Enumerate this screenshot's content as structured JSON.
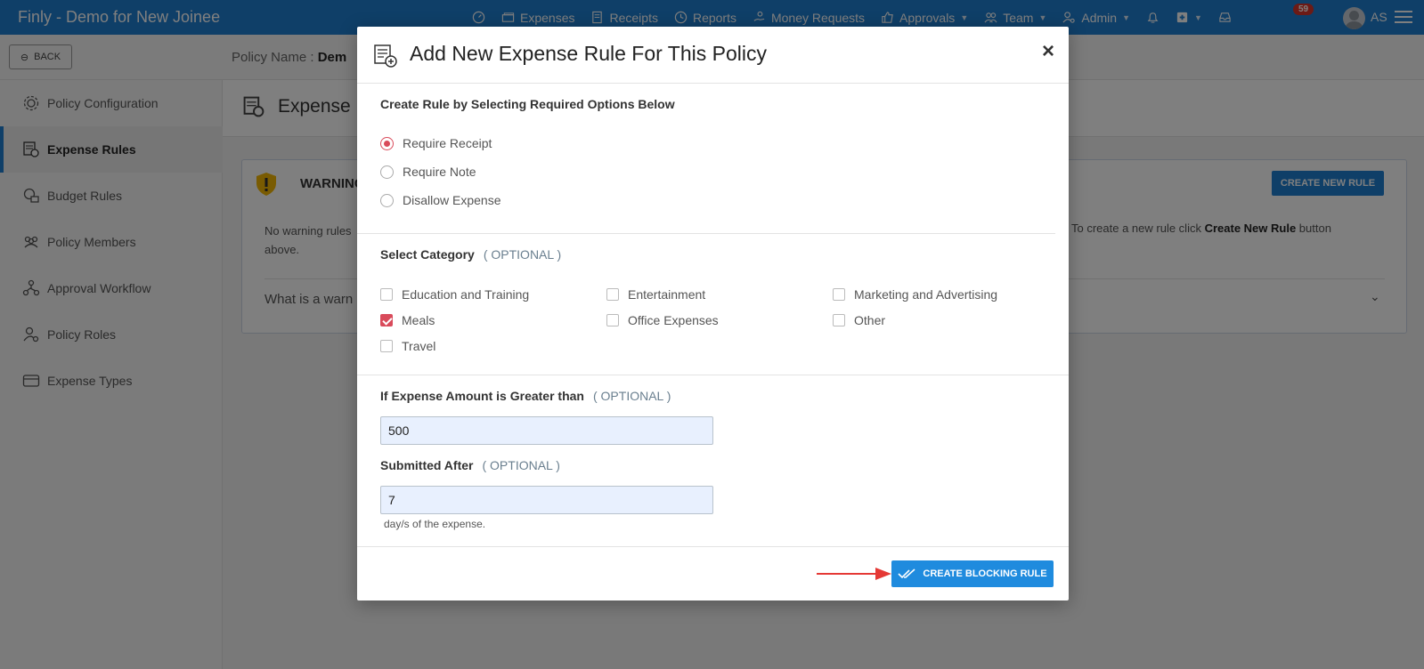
{
  "app": {
    "title": "Finly - Demo for New Joinee"
  },
  "nav": {
    "items": [
      {
        "label": ""
      },
      {
        "label": "Expenses"
      },
      {
        "label": "Receipts"
      },
      {
        "label": "Reports"
      },
      {
        "label": "Money Requests"
      },
      {
        "label": "Approvals"
      },
      {
        "label": "Team"
      },
      {
        "label": "Admin"
      }
    ],
    "inbox_count": "59",
    "user_initials": "AS"
  },
  "subbar": {
    "back_label": "BACK",
    "policy_label": "Policy Name :",
    "policy_value": "Dem"
  },
  "sidebar": {
    "items": [
      {
        "label": "Policy Configuration"
      },
      {
        "label": "Expense Rules"
      },
      {
        "label": "Budget Rules"
      },
      {
        "label": "Policy Members"
      },
      {
        "label": "Approval Workflow"
      },
      {
        "label": "Policy Roles"
      },
      {
        "label": "Expense Types"
      }
    ]
  },
  "main": {
    "title": "Expense",
    "warning_title": "WARNING",
    "create_new_rule": "CREATE NEW RULE",
    "warning_text_left": "No warning rules",
    "warning_text_left2": "above.",
    "warning_text_right_pre": "To create a new rule click ",
    "warning_text_right_bold": "Create New Rule",
    "warning_text_right_post": " button",
    "faq": "What is a warn"
  },
  "modal": {
    "title": "Add New Expense Rule For This Policy",
    "close": "×",
    "rule_section_label": "Create Rule by Selecting Required Options Below",
    "radios": [
      {
        "label": "Require Receipt",
        "selected": true
      },
      {
        "label": "Require Note",
        "selected": false
      },
      {
        "label": "Disallow Expense",
        "selected": false
      }
    ],
    "category_label": "Select Category",
    "optional": "( OPTIONAL )",
    "categories": [
      {
        "label": "Education and Training",
        "checked": false
      },
      {
        "label": "Entertainment",
        "checked": false
      },
      {
        "label": "Marketing and Advertising",
        "checked": false
      },
      {
        "label": "Meals",
        "checked": true
      },
      {
        "label": "Office Expenses",
        "checked": false
      },
      {
        "label": "Other",
        "checked": false
      },
      {
        "label": "Travel",
        "checked": false
      }
    ],
    "amount_label": "If Expense Amount is Greater than",
    "amount_value": "500",
    "submitted_label": "Submitted After",
    "submitted_value": "7",
    "days_suffix": "day/s of the expense.",
    "create_button": "CREATE BLOCKING RULE"
  },
  "colors": {
    "brand": "#1f7ed0",
    "accent": "#d94b5b",
    "button": "#1f8bde",
    "arrow": "#e53935"
  }
}
